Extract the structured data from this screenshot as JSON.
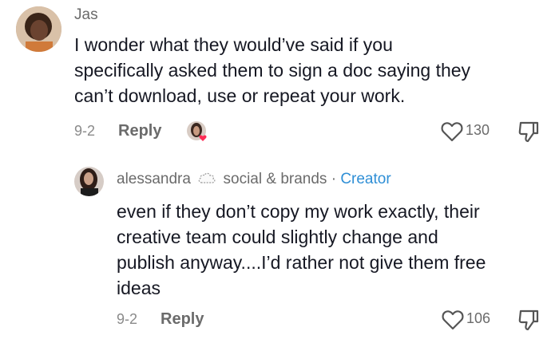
{
  "comments": [
    {
      "username": "Jas",
      "text_lines": [
        "I wonder what they would’ve said if you",
        "specifically asked them to sign a doc saying they",
        "can’t download, use or repeat your work."
      ],
      "date": "9-2",
      "reply_label": "Reply",
      "likes": "130",
      "icons": {
        "like": "heart-outline-icon",
        "dislike": "thumbs-down-outline-icon",
        "creator_liked": "creator-liked-avatar-icon"
      }
    },
    {
      "username": "alessandra",
      "username_suffix": "social & brands",
      "separator": "·",
      "badge": "Creator",
      "text_lines": [
        "even if they don’t copy my work exactly, their",
        "creative team could slightly change and",
        "publish anyway....I’d rather not give them free",
        "ideas"
      ],
      "date": "9-2",
      "reply_label": "Reply",
      "likes": "106",
      "icons": {
        "like": "heart-outline-icon",
        "dislike": "thumbs-down-outline-icon",
        "emoji": "cloud-emoji-icon"
      }
    }
  ],
  "colors": {
    "creator_badge": "#2f8fd6",
    "text": "#161823",
    "muted": "#8a8a8a",
    "heart": "#fe2c55"
  }
}
